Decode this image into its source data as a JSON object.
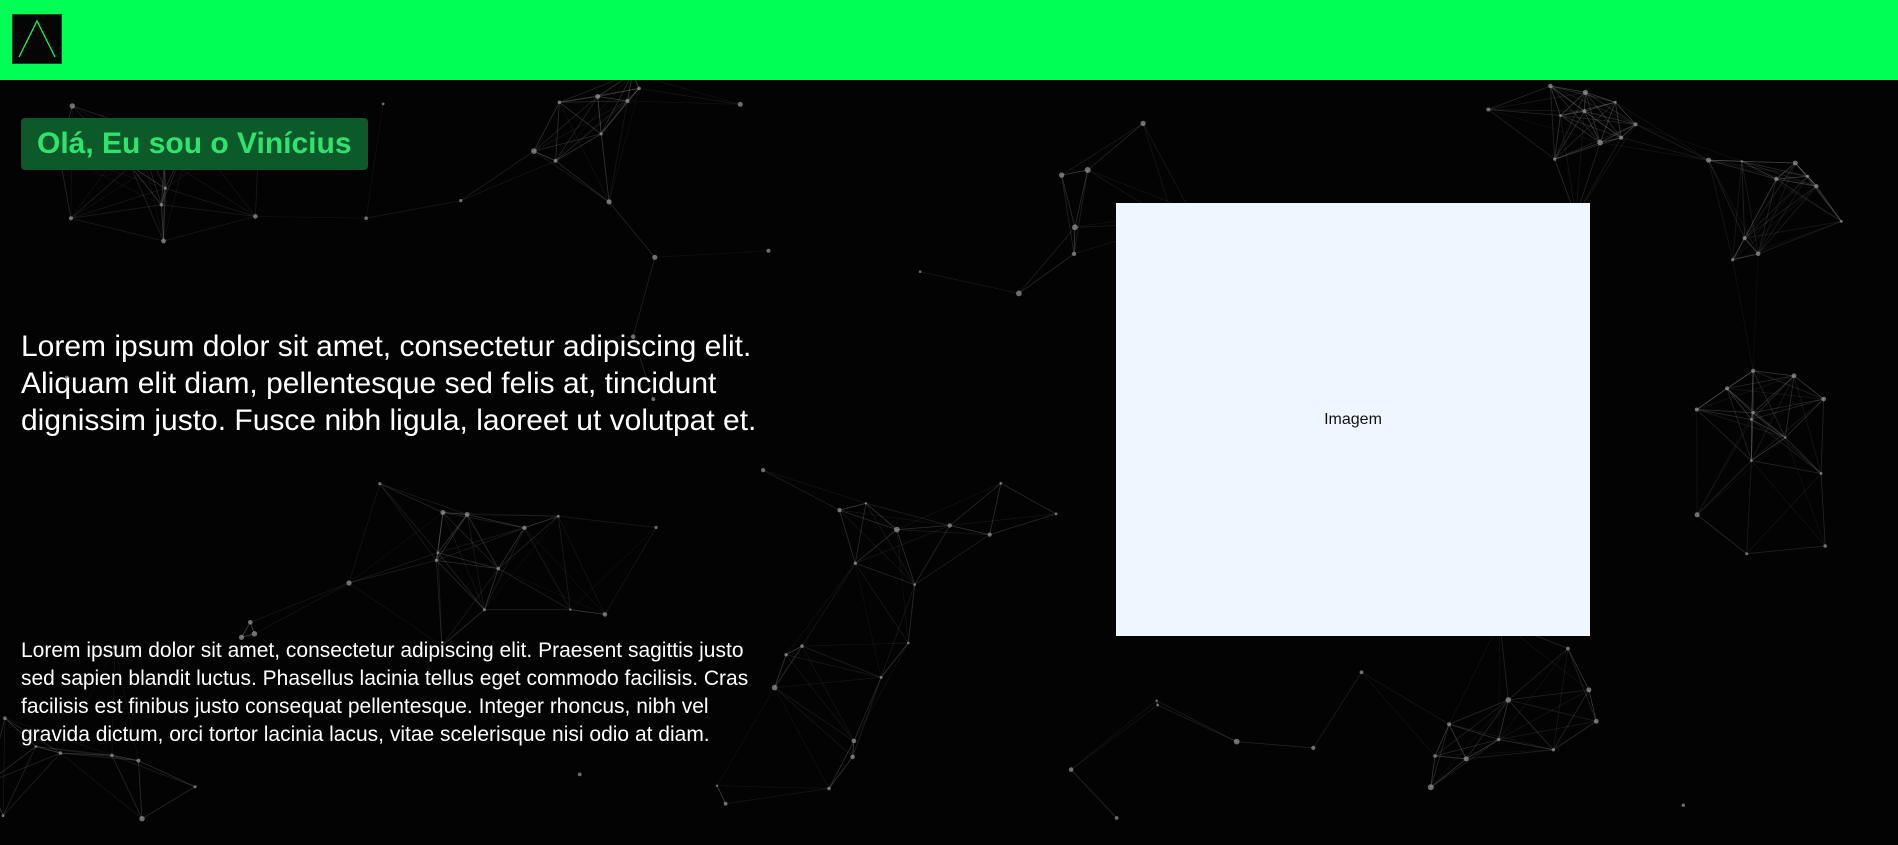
{
  "header": {
    "logo_icon": "triangle-logo-icon",
    "background_color": "#00ff55"
  },
  "hero": {
    "greeting": "Olá, Eu sou o Vinícius",
    "lead": "Lorem ipsum dolor sit amet, consectetur adipiscing elit. Aliquam elit diam, pellentesque sed felis at, tincidunt dignissim justo. Fusce nibh ligula, laoreet ut volutpat et.",
    "body": "Lorem ipsum dolor sit amet, consectetur adipiscing elit. Praesent sagittis justo sed sapien blandit luctus. Phasellus lacinia tellus eget commodo facilisis. Cras facilisis est finibus justo consequat pellentesque. Integer rhoncus, nibh vel gravida dictum, orci tortor lacinia lacus, vitae scelerisque nisi odio at diam.",
    "image_placeholder": "Imagem"
  },
  "theme": {
    "accent": "#00ff55",
    "greeting_text": "#2fe36d",
    "greeting_bg": "#0c5a2a",
    "page_bg": "#030303",
    "image_bg": "#eef6ff"
  },
  "background": {
    "pattern": "particle-network"
  }
}
